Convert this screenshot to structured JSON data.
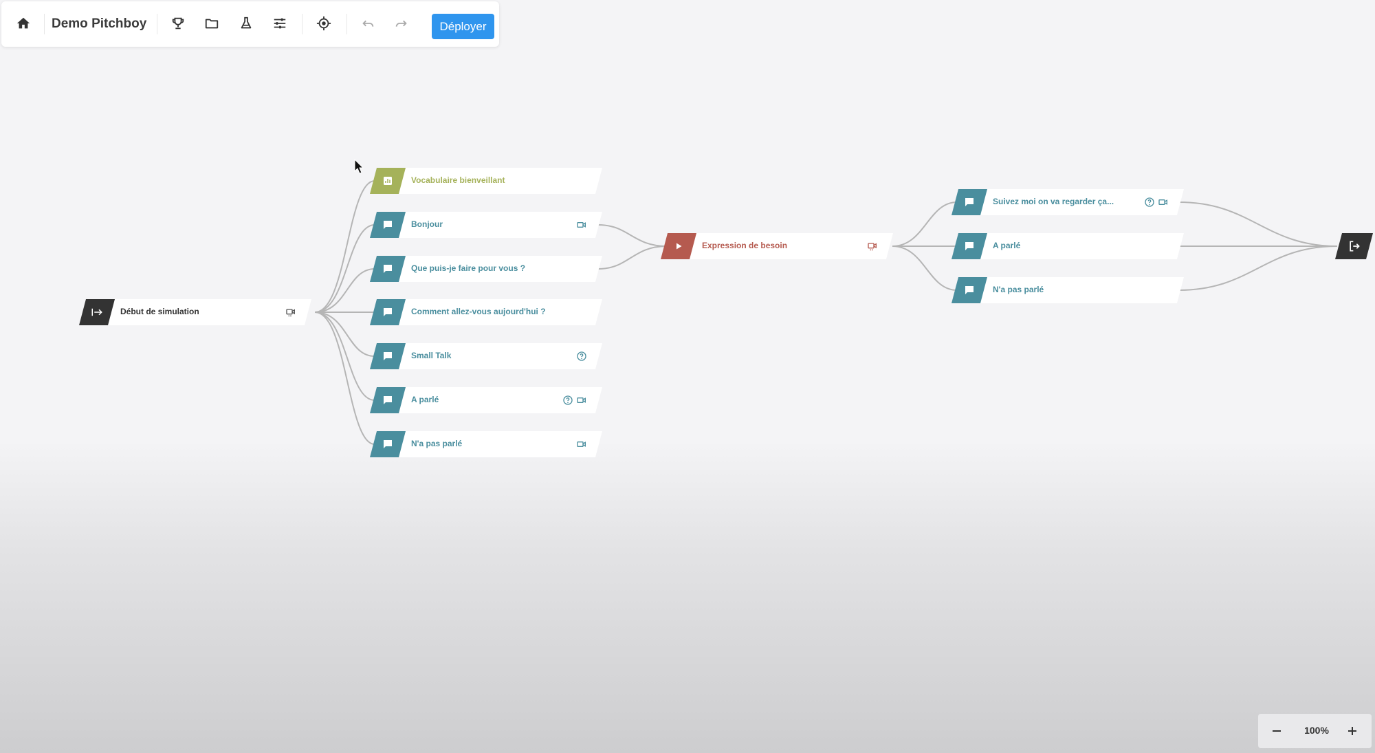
{
  "app": {
    "title": "Demo Pitchboy",
    "deploy_label": "Déployer",
    "toolbar_icons": [
      "home-icon",
      "trophy-icon",
      "folder-icon",
      "flask-icon",
      "sliders-icon",
      "target-icon",
      "undo-icon",
      "redo-icon"
    ]
  },
  "colors": {
    "teal": "#4a8e9e",
    "olive": "#a5b25a",
    "red": "#b55a4f",
    "dark": "#333333",
    "deploy": "#2f95ee"
  },
  "flow": {
    "start": {
      "label": "Début de simulation",
      "icons": [
        "video-icon"
      ]
    },
    "first_branch": [
      {
        "label": "Vocabulaire bienveillant",
        "kind": "olive",
        "icons": []
      },
      {
        "label": "Bonjour",
        "kind": "teal",
        "icons": [
          "video-icon"
        ]
      },
      {
        "label": "Que puis-je faire pour vous ?",
        "kind": "teal",
        "icons": []
      },
      {
        "label": "Comment allez-vous aujourd'hui ?",
        "kind": "teal",
        "icons": []
      },
      {
        "label": "Small Talk",
        "kind": "teal",
        "icons": [
          "help-icon"
        ]
      },
      {
        "label": "A parlé",
        "kind": "teal",
        "icons": [
          "help-icon",
          "video-icon"
        ]
      },
      {
        "label": "N'a pas parlé",
        "kind": "teal",
        "icons": [
          "video-icon"
        ]
      }
    ],
    "middle": {
      "label": "Expression de besoin",
      "icons": [
        "video-icon"
      ]
    },
    "second_branch": [
      {
        "label": "Suivez moi on va regarder ça...",
        "kind": "teal",
        "icons": [
          "help-icon",
          "video-icon"
        ]
      },
      {
        "label": "A parlé",
        "kind": "teal",
        "icons": []
      },
      {
        "label": "N'a pas parlé",
        "kind": "teal",
        "icons": []
      }
    ]
  },
  "zoom": {
    "level": "100%"
  }
}
